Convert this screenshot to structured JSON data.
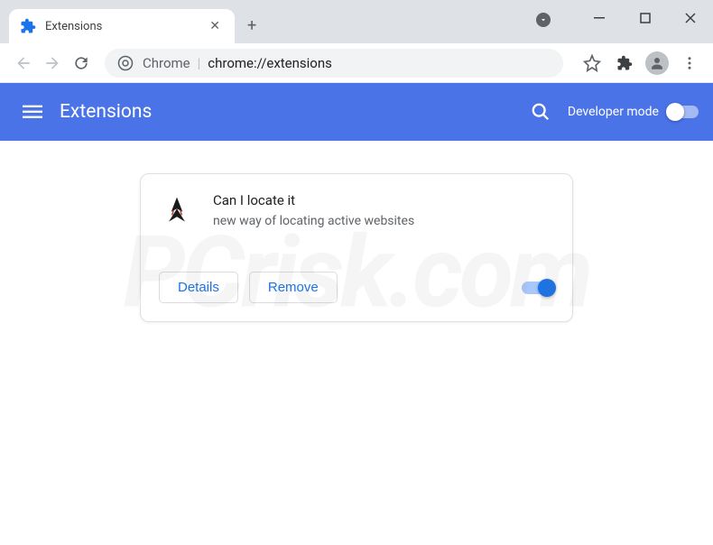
{
  "window": {
    "tab_title": "Extensions"
  },
  "omnibox": {
    "prefix": "Chrome",
    "url": "chrome://extensions"
  },
  "header": {
    "title": "Extensions",
    "devmode_label": "Developer mode"
  },
  "extension": {
    "name": "Can I locate it",
    "description": "new way of locating active websites",
    "details_label": "Details",
    "remove_label": "Remove"
  },
  "watermark": "PCrisk.com"
}
